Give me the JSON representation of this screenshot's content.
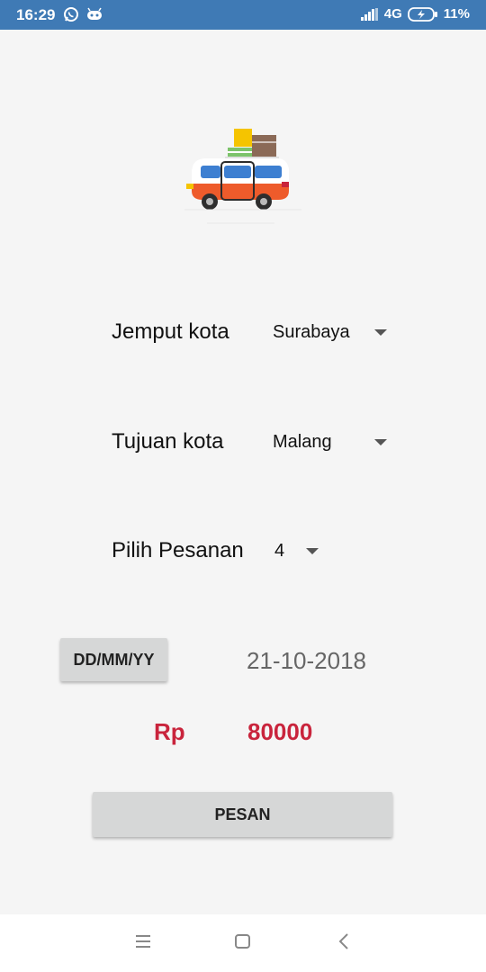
{
  "status_bar": {
    "time": "16:29",
    "network": "4G",
    "battery": "11%",
    "icons": [
      "whatsapp-icon",
      "notification-icon",
      "signal-icon",
      "battery-charging-icon"
    ]
  },
  "form": {
    "pickup": {
      "label": "Jemput kota",
      "value": "Surabaya"
    },
    "destination": {
      "label": "Tujuan kota",
      "value": "Malang"
    },
    "order": {
      "label": "Pilih Pesanan",
      "value": "4"
    }
  },
  "date": {
    "button_label": "DD/MM/YY",
    "value": "21-10-2018"
  },
  "price": {
    "currency": "Rp",
    "amount": "80000"
  },
  "submit_label": "PESAN",
  "nav": {
    "icons": [
      "menu-icon",
      "home-icon",
      "back-icon"
    ]
  },
  "colors": {
    "status_bar": "#3f7ab5",
    "accent_price": "#c9243c",
    "button": "#d6d7d7"
  }
}
